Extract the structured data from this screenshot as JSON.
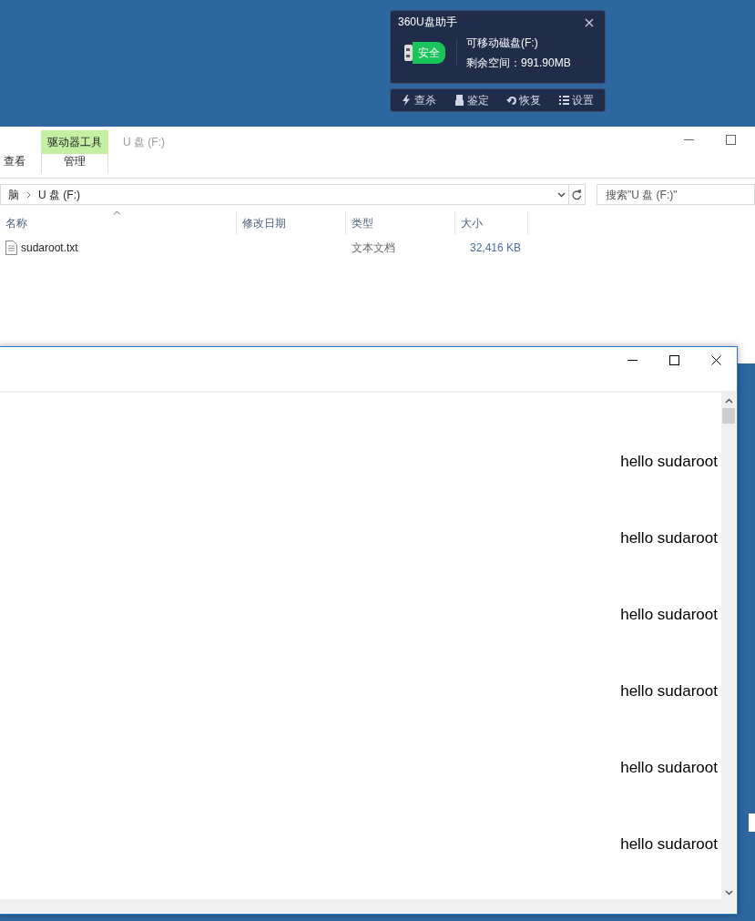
{
  "usb_helper": {
    "title": "360U盘助手",
    "badge": "安全",
    "drive_name": "可移动磁盘(F:)",
    "free_space": "剩余空间：991.90MB",
    "actions": [
      {
        "label": "查杀",
        "kind": "scan"
      },
      {
        "label": "鉴定",
        "kind": "usb"
      },
      {
        "label": "恢复",
        "kind": "restore"
      },
      {
        "label": "设置",
        "kind": "settings"
      }
    ]
  },
  "explorer": {
    "context_tab": "驱动器工具",
    "title": "U 盘 (F:)",
    "ribbon_tabs": [
      {
        "label": "查看",
        "selected": false
      },
      {
        "label": "管理",
        "selected": true
      }
    ],
    "breadcrumb": [
      "脑",
      "U 盘 (F:)"
    ],
    "search": {
      "placeholder": "搜索\"U 盘 (F:)\""
    },
    "columns": [
      {
        "label": "名称",
        "sorted": true
      },
      {
        "label": "修改日期",
        "sorted": false
      },
      {
        "label": "类型",
        "sorted": false
      },
      {
        "label": "大小",
        "sorted": false
      }
    ],
    "files": [
      {
        "name": "sudaroot.txt",
        "type": "文本文档",
        "size": "32,416 KB"
      }
    ]
  },
  "notepad": {
    "lines": [
      "hello sudaroot",
      "hello sudaroot",
      "hello sudaroot",
      "hello sudaroot",
      "hello sudaroot",
      "hello sudaroot"
    ]
  }
}
